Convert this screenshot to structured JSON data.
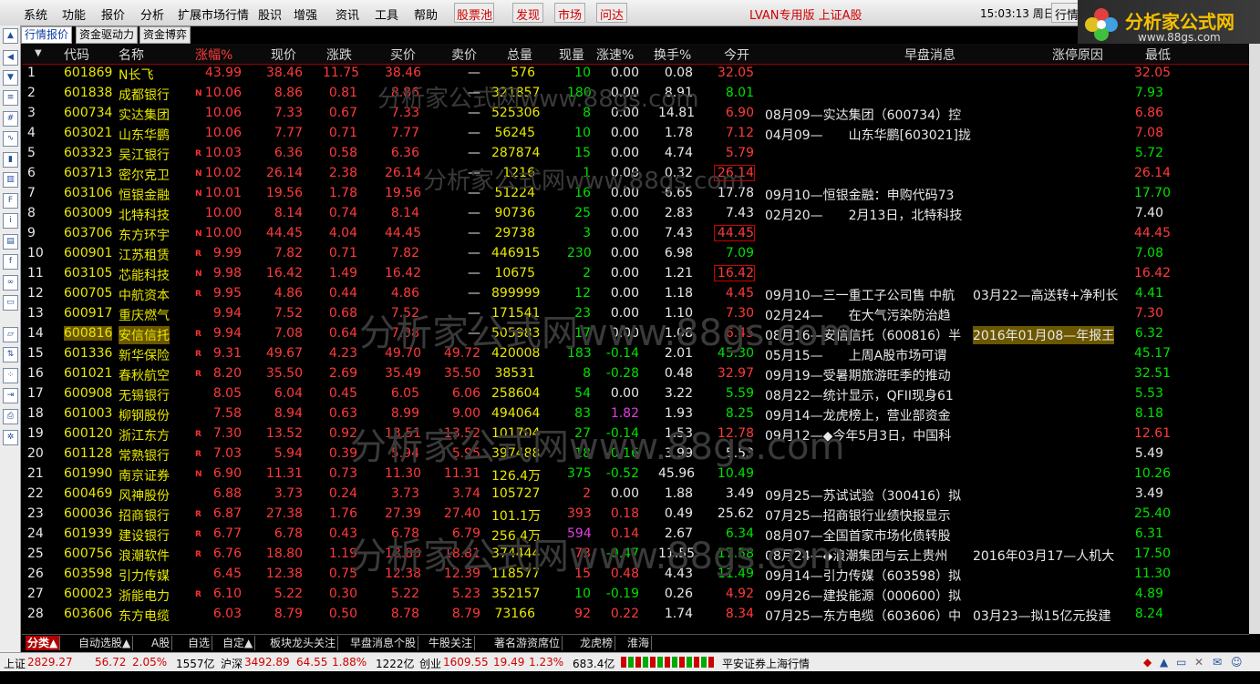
{
  "menu": {
    "items": [
      "系统",
      "功能",
      "报价",
      "分析",
      "扩展市场行情",
      "股识",
      "增强",
      "资讯",
      "工具",
      "帮助"
    ],
    "red_items": [
      "股票池",
      "发现",
      "市场",
      "问达"
    ],
    "version_label": "LVAN专用版 上证A股",
    "clock": "15:03:13 周日",
    "quote_btn": "行情"
  },
  "logo": {
    "text": "分析家公式网",
    "url": "www.88gs.com"
  },
  "tabs": [
    "行情报价",
    "资金驱动力",
    "资金博弈"
  ],
  "columns": [
    "代码",
    "名称",
    "涨幅%",
    "现价",
    "涨跌",
    "买价",
    "卖价",
    "总量",
    "现量",
    "涨速%",
    "换手%",
    "今开",
    "早盘消息",
    "涨停原因",
    "最低"
  ],
  "rows": [
    {
      "no": "1",
      "code": "601869",
      "name": "N长飞",
      "flag": "",
      "pct": "43.99",
      "price": "38.46",
      "chg": "11.75",
      "bid": "38.46",
      "ask": "—",
      "vol": "576",
      "cur": "10",
      "spd": "0.00",
      "turn": "0.08",
      "open": "32.05",
      "news": "",
      "reason": "",
      "low": "32.05"
    },
    {
      "no": "2",
      "code": "601838",
      "name": "成都银行",
      "flag": "N",
      "pct": "10.06",
      "price": "8.86",
      "chg": "0.81",
      "bid": "8.86",
      "ask": "—",
      "vol": "321857",
      "cur": "180",
      "spd": "0.00",
      "turn": "8.91",
      "open": "8.01",
      "news": "",
      "reason": "",
      "low": "7.93"
    },
    {
      "no": "3",
      "code": "600734",
      "name": "实达集团",
      "flag": "",
      "pct": "10.06",
      "price": "7.33",
      "chg": "0.67",
      "bid": "7.33",
      "ask": "—",
      "vol": "525306",
      "cur": "8",
      "spd": "0.00",
      "turn": "14.81",
      "open": "6.90",
      "news": "08月09—实达集团（600734）控",
      "reason": "",
      "low": "6.86"
    },
    {
      "no": "4",
      "code": "603021",
      "name": "山东华鹏",
      "flag": "",
      "pct": "10.06",
      "price": "7.77",
      "chg": "0.71",
      "bid": "7.77",
      "ask": "—",
      "vol": "56245",
      "cur": "10",
      "spd": "0.00",
      "turn": "1.78",
      "open": "7.12",
      "news": "04月09—　　山东华鹏[603021]拢",
      "reason": "",
      "low": "7.08"
    },
    {
      "no": "5",
      "code": "603323",
      "name": "吴江银行",
      "flag": "R",
      "pct": "10.03",
      "price": "6.36",
      "chg": "0.58",
      "bid": "6.36",
      "ask": "—",
      "vol": "287874",
      "cur": "15",
      "spd": "0.00",
      "turn": "4.74",
      "open": "5.79",
      "news": "",
      "reason": "",
      "low": "5.72"
    },
    {
      "no": "6",
      "code": "603713",
      "name": "密尔克卫",
      "flag": "N",
      "pct": "10.02",
      "price": "26.14",
      "chg": "2.38",
      "bid": "26.14",
      "ask": "—",
      "vol": "1216",
      "cur": "1",
      "spd": "0.00",
      "turn": "0.32",
      "open": "26.14",
      "news": "",
      "reason": "",
      "low": "26.14"
    },
    {
      "no": "7",
      "code": "603106",
      "name": "恒银金融",
      "flag": "N",
      "pct": "10.01",
      "price": "19.56",
      "chg": "1.78",
      "bid": "19.56",
      "ask": "—",
      "vol": "51224",
      "cur": "16",
      "spd": "0.00",
      "turn": "6.65",
      "open": "17.78",
      "news": "09月10—恒银金融：申购代码73",
      "reason": "",
      "low": "17.70"
    },
    {
      "no": "8",
      "code": "603009",
      "name": "北特科技",
      "flag": "",
      "pct": "10.00",
      "price": "8.14",
      "chg": "0.74",
      "bid": "8.14",
      "ask": "—",
      "vol": "90736",
      "cur": "25",
      "spd": "0.00",
      "turn": "2.83",
      "open": "7.43",
      "news": "02月20—　　2月13日，北特科技",
      "reason": "",
      "low": "7.40"
    },
    {
      "no": "9",
      "code": "603706",
      "name": "东方环宇",
      "flag": "N",
      "pct": "10.00",
      "price": "44.45",
      "chg": "4.04",
      "bid": "44.45",
      "ask": "—",
      "vol": "29738",
      "cur": "3",
      "spd": "0.00",
      "turn": "7.43",
      "open": "44.45",
      "news": "",
      "reason": "",
      "low": "44.45"
    },
    {
      "no": "10",
      "code": "600901",
      "name": "江苏租赁",
      "flag": "R",
      "pct": "9.99",
      "price": "7.82",
      "chg": "0.71",
      "bid": "7.82",
      "ask": "—",
      "vol": "446915",
      "cur": "230",
      "spd": "0.00",
      "turn": "6.98",
      "open": "7.09",
      "news": "",
      "reason": "",
      "low": "7.08"
    },
    {
      "no": "11",
      "code": "603105",
      "name": "芯能科技",
      "flag": "N",
      "pct": "9.98",
      "price": "16.42",
      "chg": "1.49",
      "bid": "16.42",
      "ask": "—",
      "vol": "10675",
      "cur": "2",
      "spd": "0.00",
      "turn": "1.21",
      "open": "16.42",
      "news": "",
      "reason": "",
      "low": "16.42"
    },
    {
      "no": "12",
      "code": "600705",
      "name": "中航资本",
      "flag": "R",
      "pct": "9.95",
      "price": "4.86",
      "chg": "0.44",
      "bid": "4.86",
      "ask": "—",
      "vol": "899999",
      "cur": "12",
      "spd": "0.00",
      "turn": "1.18",
      "open": "4.45",
      "news": "09月10—三一重工子公司售 中航",
      "reason": "03月22—高送转+净利长",
      "low": "4.41"
    },
    {
      "no": "13",
      "code": "600917",
      "name": "重庆燃气",
      "flag": "",
      "pct": "9.94",
      "price": "7.52",
      "chg": "0.68",
      "bid": "7.52",
      "ask": "—",
      "vol": "171541",
      "cur": "23",
      "spd": "0.00",
      "turn": "1.10",
      "open": "7.30",
      "news": "02月24—　　在大气污染防治趋",
      "reason": "",
      "low": "7.30"
    },
    {
      "no": "14",
      "code": "600816",
      "name": "安信信托",
      "flag": "R",
      "pct": "9.94",
      "price": "7.08",
      "chg": "0.64",
      "bid": "7.08",
      "ask": "—",
      "vol": "505983",
      "cur": "17",
      "spd": "0.00",
      "turn": "1.08",
      "open": "6.45",
      "news": "08月16—安信信托（600816）半",
      "reason": "2016年01月08—年报王",
      "low": "6.32"
    },
    {
      "no": "15",
      "code": "601336",
      "name": "新华保险",
      "flag": "R",
      "pct": "9.31",
      "price": "49.67",
      "chg": "4.23",
      "bid": "49.70",
      "ask": "49.72",
      "vol": "420008",
      "cur": "183",
      "spd": "-0.14",
      "turn": "2.01",
      "open": "45.30",
      "news": "05月15—　　上周A股市场可谓",
      "reason": "",
      "low": "45.17"
    },
    {
      "no": "16",
      "code": "601021",
      "name": "春秋航空",
      "flag": "R",
      "pct": "8.20",
      "price": "35.50",
      "chg": "2.69",
      "bid": "35.49",
      "ask": "35.50",
      "vol": "38531",
      "cur": "8",
      "spd": "-0.28",
      "turn": "0.48",
      "open": "32.97",
      "news": "09月19—受暑期旅游旺季的推动",
      "reason": "",
      "low": "32.51"
    },
    {
      "no": "17",
      "code": "600908",
      "name": "无锡银行",
      "flag": "",
      "pct": "8.05",
      "price": "6.04",
      "chg": "0.45",
      "bid": "6.05",
      "ask": "6.06",
      "vol": "258604",
      "cur": "54",
      "spd": "0.00",
      "turn": "3.22",
      "open": "5.59",
      "news": "08月22—统计显示，QFII现身61",
      "reason": "",
      "low": "5.53"
    },
    {
      "no": "18",
      "code": "601003",
      "name": "柳钢股份",
      "flag": "",
      "pct": "7.58",
      "price": "8.94",
      "chg": "0.63",
      "bid": "8.99",
      "ask": "9.00",
      "vol": "494064",
      "cur": "83",
      "spd": "1.82",
      "turn": "1.93",
      "open": "8.25",
      "news": "09月14—龙虎榜上，营业部资金",
      "reason": "",
      "low": "8.18"
    },
    {
      "no": "19",
      "code": "600120",
      "name": "浙江东方",
      "flag": "R",
      "pct": "7.30",
      "price": "13.52",
      "chg": "0.92",
      "bid": "13.51",
      "ask": "13.52",
      "vol": "101704",
      "cur": "27",
      "spd": "-0.14",
      "turn": "1.53",
      "open": "12.78",
      "news": "09月12—◆今年5月3日，中国科",
      "reason": "",
      "low": "12.61"
    },
    {
      "no": "20",
      "code": "601128",
      "name": "常熟银行",
      "flag": "R",
      "pct": "7.03",
      "price": "5.94",
      "chg": "0.39",
      "bid": "5.94",
      "ask": "5.95",
      "vol": "397488",
      "cur": "18",
      "spd": "-0.16",
      "turn": "3.99",
      "open": "5.53",
      "news": "",
      "reason": "",
      "low": "5.49"
    },
    {
      "no": "21",
      "code": "601990",
      "name": "南京证券",
      "flag": "N",
      "pct": "6.90",
      "price": "11.31",
      "chg": "0.73",
      "bid": "11.30",
      "ask": "11.31",
      "vol": "126.4万",
      "cur": "375",
      "spd": "-0.52",
      "turn": "45.96",
      "open": "10.49",
      "news": "",
      "reason": "",
      "low": "10.26"
    },
    {
      "no": "22",
      "code": "600469",
      "name": "风神股份",
      "flag": "",
      "pct": "6.88",
      "price": "3.73",
      "chg": "0.24",
      "bid": "3.73",
      "ask": "3.74",
      "vol": "105727",
      "cur": "2",
      "spd": "0.00",
      "turn": "1.88",
      "open": "3.49",
      "news": "09月25—苏试试验（300416）拟",
      "reason": "",
      "low": "3.49"
    },
    {
      "no": "23",
      "code": "600036",
      "name": "招商银行",
      "flag": "R",
      "pct": "6.87",
      "price": "27.38",
      "chg": "1.76",
      "bid": "27.39",
      "ask": "27.40",
      "vol": "101.1万",
      "cur": "393",
      "spd": "0.18",
      "turn": "0.49",
      "open": "25.62",
      "news": "07月25—招商银行业绩快报显示",
      "reason": "",
      "low": "25.40"
    },
    {
      "no": "24",
      "code": "601939",
      "name": "建设银行",
      "flag": "R",
      "pct": "6.77",
      "price": "6.78",
      "chg": "0.43",
      "bid": "6.78",
      "ask": "6.79",
      "vol": "256.4万",
      "cur": "594",
      "spd": "0.14",
      "turn": "2.67",
      "open": "6.34",
      "news": "08月07—全国首家市场化债转股",
      "reason": "",
      "low": "6.31"
    },
    {
      "no": "25",
      "code": "600756",
      "name": "浪潮软件",
      "flag": "R",
      "pct": "6.76",
      "price": "18.80",
      "chg": "1.19",
      "bid": "18.80",
      "ask": "18.81",
      "vol": "374444",
      "cur": "73",
      "spd": "-0.47",
      "turn": "11.55",
      "open": "17.58",
      "news": "08月24—◆浪潮集团与云上贵州",
      "reason": "2016年03月17—人机大",
      "low": "17.50"
    },
    {
      "no": "26",
      "code": "603598",
      "name": "引力传媒",
      "flag": "",
      "pct": "6.45",
      "price": "12.38",
      "chg": "0.75",
      "bid": "12.38",
      "ask": "12.39",
      "vol": "118577",
      "cur": "15",
      "spd": "0.48",
      "turn": "4.43",
      "open": "11.49",
      "news": "09月14—引力传媒（603598）拟",
      "reason": "",
      "low": "11.30"
    },
    {
      "no": "27",
      "code": "600023",
      "name": "浙能电力",
      "flag": "R",
      "pct": "6.10",
      "price": "5.22",
      "chg": "0.30",
      "bid": "5.22",
      "ask": "5.23",
      "vol": "352157",
      "cur": "10",
      "spd": "-0.19",
      "turn": "0.26",
      "open": "4.92",
      "news": "09月26—建投能源（000600）拟",
      "reason": "",
      "low": "4.89"
    },
    {
      "no": "28",
      "code": "603606",
      "name": "东方电缆",
      "flag": "",
      "pct": "6.03",
      "price": "8.79",
      "chg": "0.50",
      "bid": "8.78",
      "ask": "8.79",
      "vol": "73166",
      "cur": "92",
      "spd": "0.22",
      "turn": "1.74",
      "open": "8.34",
      "news": "07月25—东方电缆（603606）中",
      "reason": "03月23—拟15亿元投建",
      "low": "8.24"
    }
  ],
  "bottom_tabs": [
    "分类▲",
    "自动选股▲",
    "A股",
    "自选",
    "自定▲",
    "板块龙头关注",
    "早盘消息个股",
    "牛股关注",
    "著名游资席位",
    "龙虎榜",
    "淮海"
  ],
  "status": {
    "sh_label": "上证",
    "sh_val": "2829.27",
    "sh_chg": "56.72",
    "sh_pct": "2.05%",
    "sh_amt": "1557亿",
    "hs_label": "沪深",
    "hs_val": "3492.89",
    "hs_chg": "64.55",
    "hs_pct": "1.88%",
    "hs_amt": "1222亿",
    "cy_label": "创业",
    "cy_val": "1609.55",
    "cy_chg": "19.49",
    "cy_pct": "1.23%",
    "cy_amt": "683.4亿",
    "broker": "平安证券上海行情"
  },
  "watermark": "分析家公式网www.88gs.com",
  "colors": {
    "up": "#ff3a3a",
    "down": "#00e000",
    "flat": "#e8e8e8",
    "price_yellow": "#e8e800"
  }
}
